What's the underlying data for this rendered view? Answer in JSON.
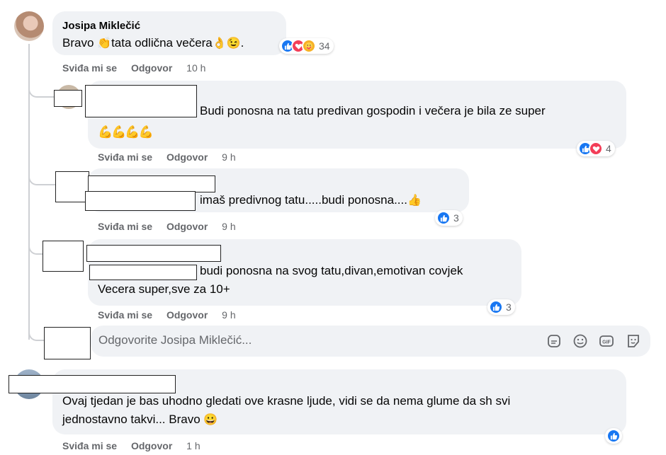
{
  "comments": [
    {
      "author": "Josipa Miklečić",
      "text_parts": [
        "Bravo ",
        "👏",
        "tata odlična večera",
        "👌",
        "😉",
        "."
      ],
      "reactions": {
        "icons": [
          "like-icon",
          "love-icon",
          "care-icon"
        ],
        "count": "34"
      },
      "actions": {
        "like": "Sviđa mi se",
        "reply": "Odgovor",
        "time": "10 h"
      }
    }
  ],
  "replies": [
    {
      "text_line1": "Budi ponosna na tatu predivan gospodin i večera je bila ze super",
      "text_line2": "💪💪💪💪",
      "reactions": {
        "icons": [
          "like-icon",
          "love-icon"
        ],
        "count": "4"
      },
      "actions": {
        "like": "Sviđa mi se",
        "reply": "Odgovor",
        "time": "9 h"
      }
    },
    {
      "text_line1": "imaš predivnog tatu.....budi ponosna....",
      "emoji": "👍",
      "reactions": {
        "icons": [
          "like-icon"
        ],
        "count": "3"
      },
      "actions": {
        "like": "Sviđa mi se",
        "reply": "Odgovor",
        "time": "9 h"
      }
    },
    {
      "text_line1": "budi ponosna na svog tatu,divan,emotivan covjek",
      "text_line2": "Vecera super,sve za 10+",
      "reactions": {
        "icons": [
          "like-icon"
        ],
        "count": "3"
      },
      "actions": {
        "like": "Sviđa mi se",
        "reply": "Odgovor",
        "time": "9 h"
      }
    }
  ],
  "reply_input": {
    "placeholder": "Odgovorite Josipa Miklečić...",
    "tools": [
      "sticker-icon",
      "emoji-icon",
      "gif-icon",
      "sticker-smile-icon"
    ]
  },
  "second_comment": {
    "text_line1": "Ovaj tjedan je bas uhodno gledati ove krasne ljude, vidi se da nema glume da sh svi",
    "text_line2": "jednostavno takvi... Bravo",
    "emoji": "😀",
    "reactions": {
      "icons": [
        "like-icon"
      ]
    },
    "actions": {
      "like": "Sviđa mi se",
      "reply": "Odgovor",
      "time": "1 h"
    }
  },
  "colors": {
    "bubble": "#f0f2f5",
    "like": "#1877f2",
    "love": "#f33e58",
    "care": "#f7b125",
    "meta": "#65676b"
  }
}
